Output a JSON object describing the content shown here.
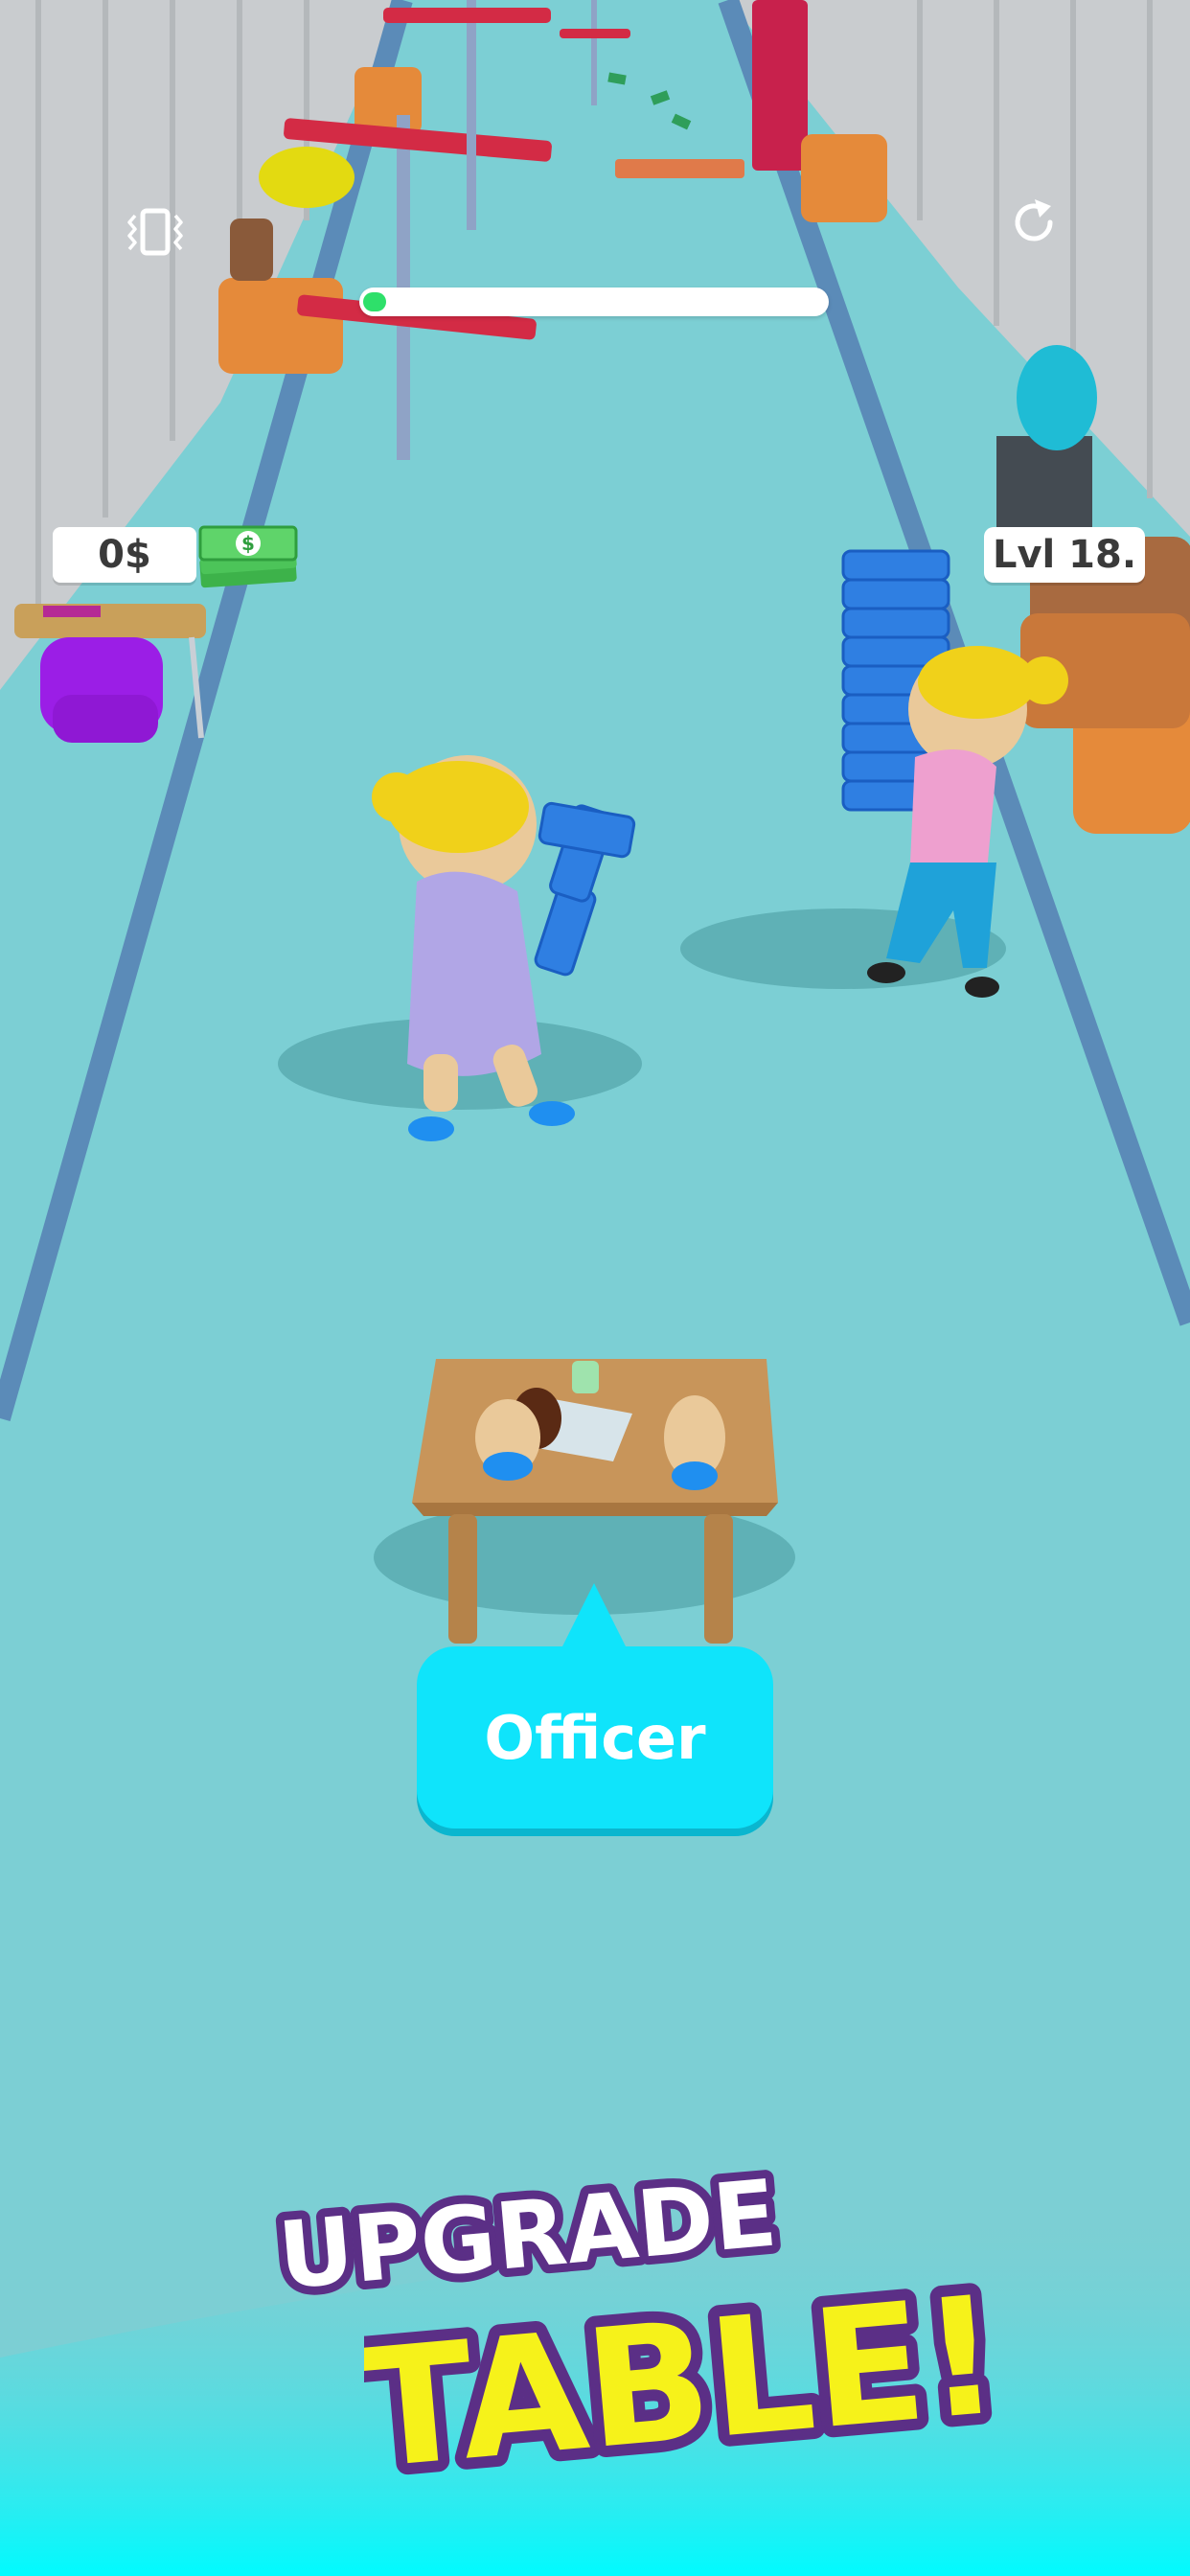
{
  "hud": {
    "vibrate_icon": "vibrate-icon",
    "restart_icon": "restart-icon",
    "progress": 0.05,
    "progress_color": "#2ee06a",
    "money": "0$",
    "cash_icon": "cash-bill-icon",
    "level": "Lvl 18."
  },
  "station": {
    "button_label": "Officer",
    "button_color": "#0fe4fb"
  },
  "promo": {
    "line1": "UPGRADE",
    "line2": "TABLE!",
    "line2_color": "#f6f21a",
    "outline_color": "#5b2f86"
  }
}
